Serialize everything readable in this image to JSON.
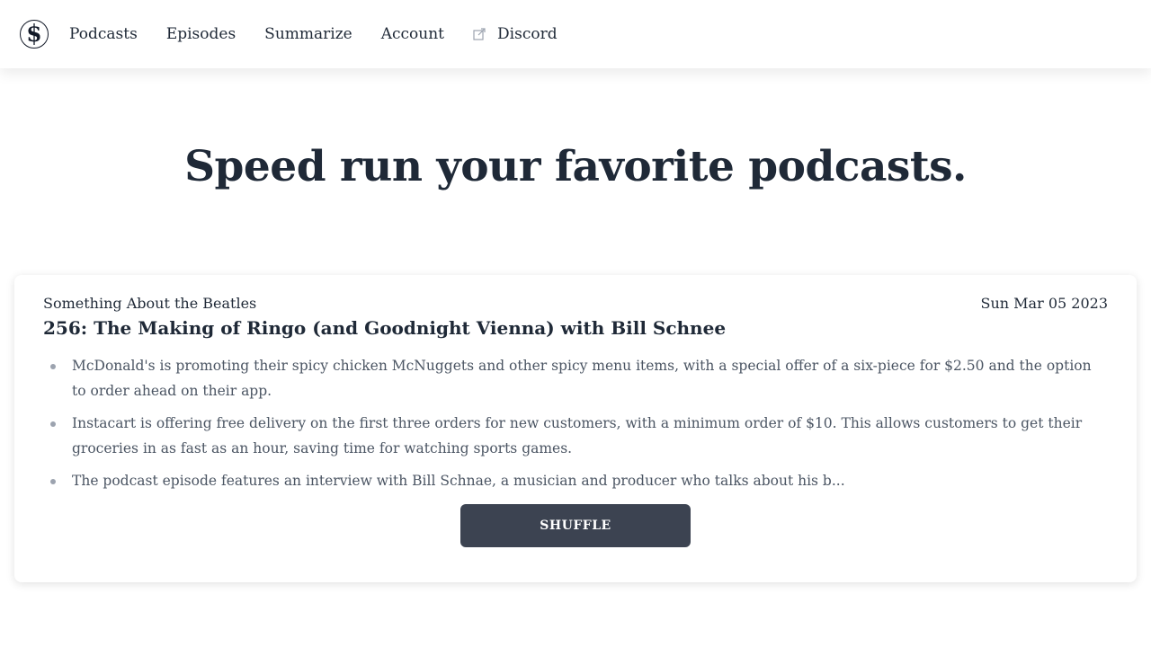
{
  "nav": {
    "items": [
      {
        "label": "Podcasts"
      },
      {
        "label": "Episodes"
      },
      {
        "label": "Summarize"
      },
      {
        "label": "Account"
      }
    ],
    "external": {
      "label": "Discord",
      "icon": "external-link-icon"
    }
  },
  "logo": {
    "icon": "logo-s-icon"
  },
  "hero": {
    "title": "Speed run your favorite podcasts."
  },
  "episode": {
    "podcast_name": "Something About the Beatles",
    "date": "Sun Mar 05 2023",
    "title": "256: The Making of Ringo (and Goodnight Vienna) with Bill Schnee",
    "bullets": [
      "McDonald's is promoting their spicy chicken McNuggets and other spicy menu items, with a special offer of a six-piece for $2.50 and the option to order ahead on their app.",
      "Instacart is offering free delivery on the first three orders for new customers, with a minimum order of $10. This allows customers to get their groceries in as fast as an hour, saving time for watching sports games.",
      "The podcast episode features an interview with Bill Schnae, a musician and producer who talks about his b..."
    ]
  },
  "actions": {
    "shuffle_label": "SHUFFLE"
  },
  "colors": {
    "text": "#1f2937",
    "muted": "#4b5563",
    "button": "#3c4351"
  }
}
